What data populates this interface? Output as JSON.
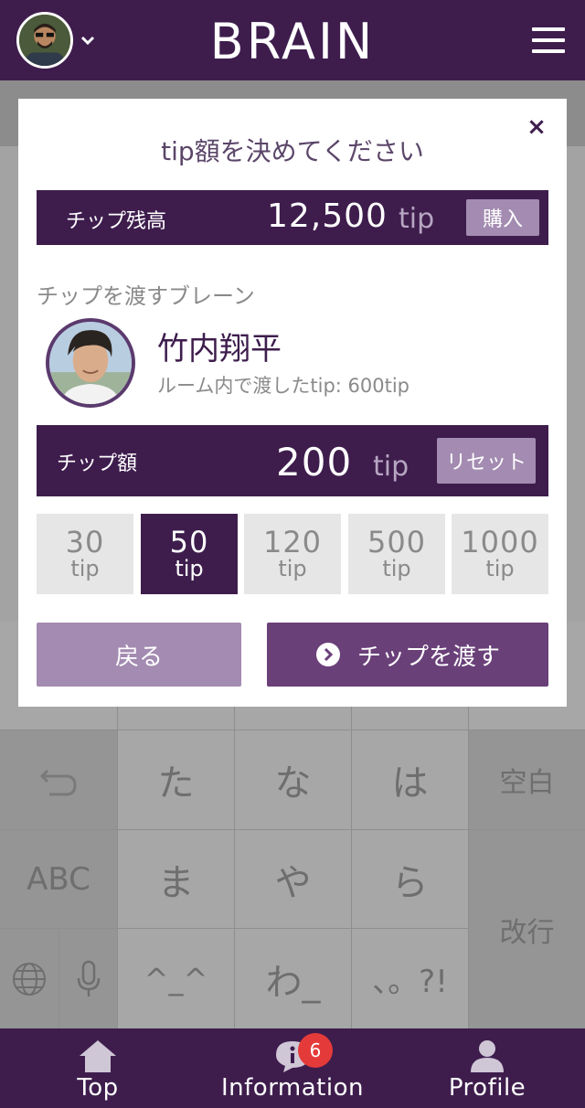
{
  "header": {
    "brand": "BRAIN"
  },
  "modal": {
    "title": "tip額を決めてください",
    "close_label": "×",
    "balance": {
      "label": "チップ残高",
      "value": "12,500",
      "unit": "tip",
      "buy_label": "購入"
    },
    "recipient_section_label": "チップを渡すブレーン",
    "brain": {
      "name": "竹内翔平",
      "sub": "ルーム内で渡したtip: 600tip"
    },
    "tip_amount": {
      "label": "チップ額",
      "value": "200",
      "unit": "tip",
      "reset_label": "リセット"
    },
    "amount_options": [
      {
        "value": "30",
        "unit": "tip",
        "selected": false
      },
      {
        "value": "50",
        "unit": "tip",
        "selected": true
      },
      {
        "value": "120",
        "unit": "tip",
        "selected": false
      },
      {
        "value": "500",
        "unit": "tip",
        "selected": false
      },
      {
        "value": "1000",
        "unit": "tip",
        "selected": false
      }
    ],
    "back_label": "戻る",
    "send_label": "チップを渡す"
  },
  "keyboard": {
    "keys": {
      "ta": "た",
      "na": "な",
      "ha": "は",
      "space": "空白",
      "abc": "ABC",
      "ma": "ま",
      "ya": "や",
      "ra": "ら",
      "enter": "改行",
      "face": "^_^",
      "wa": "わ_",
      "punct": "、。?!"
    }
  },
  "bottom_nav": {
    "items": [
      {
        "label": "Top",
        "icon": "home-icon"
      },
      {
        "label": "Information",
        "icon": "info-chat-icon",
        "badge": "6"
      },
      {
        "label": "Profile",
        "icon": "user-icon"
      }
    ]
  },
  "colors": {
    "primary": "#3e1d4d",
    "accent": "#a38bb1",
    "send": "#6a4079",
    "badge": "#e53a3a"
  }
}
